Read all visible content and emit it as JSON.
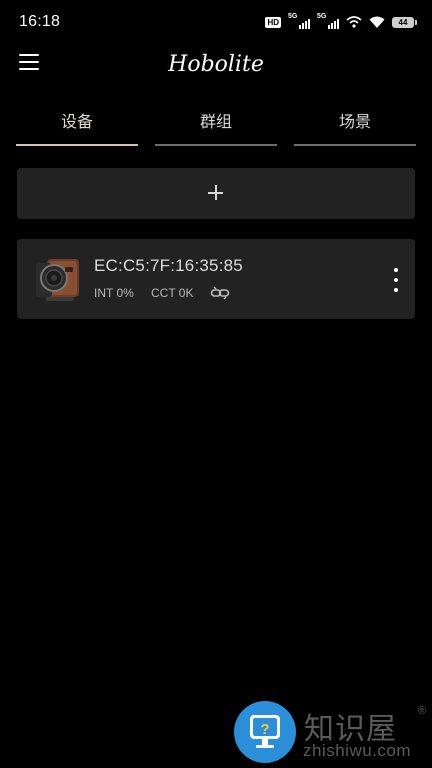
{
  "status_bar": {
    "time": "16:18",
    "hd_label": "HD",
    "sim1_label": "5G",
    "sim2_label": "5G",
    "battery_level": "44",
    "icons": [
      "hd-icon",
      "signal-icon",
      "signal-icon",
      "hotspot-icon",
      "wifi-icon",
      "battery-icon"
    ]
  },
  "header": {
    "brand": "Hobolite",
    "menu_icon": "hamburger-menu-icon"
  },
  "tabs": [
    {
      "label": "设备",
      "active": true
    },
    {
      "label": "群组",
      "active": false
    },
    {
      "label": "场景",
      "active": false
    }
  ],
  "add_button": {
    "label": "+",
    "icon": "plus-icon"
  },
  "devices": [
    {
      "name": "EC:C5:7F:16:35:85",
      "intensity": "INT 0%",
      "cct": "CCT 0K",
      "link_icon": "link-icon",
      "more_icon": "more-vertical-icon"
    }
  ],
  "watermark": {
    "name": "知识屋",
    "registered": "®",
    "url": "zhishiwu.com"
  },
  "colors": {
    "background": "#000000",
    "card": "#222222",
    "active_tab_underline": "#d2c3a8",
    "inactive_tab_underline": "#6e6e6e",
    "watermark_blue": "#2a8fd8"
  }
}
